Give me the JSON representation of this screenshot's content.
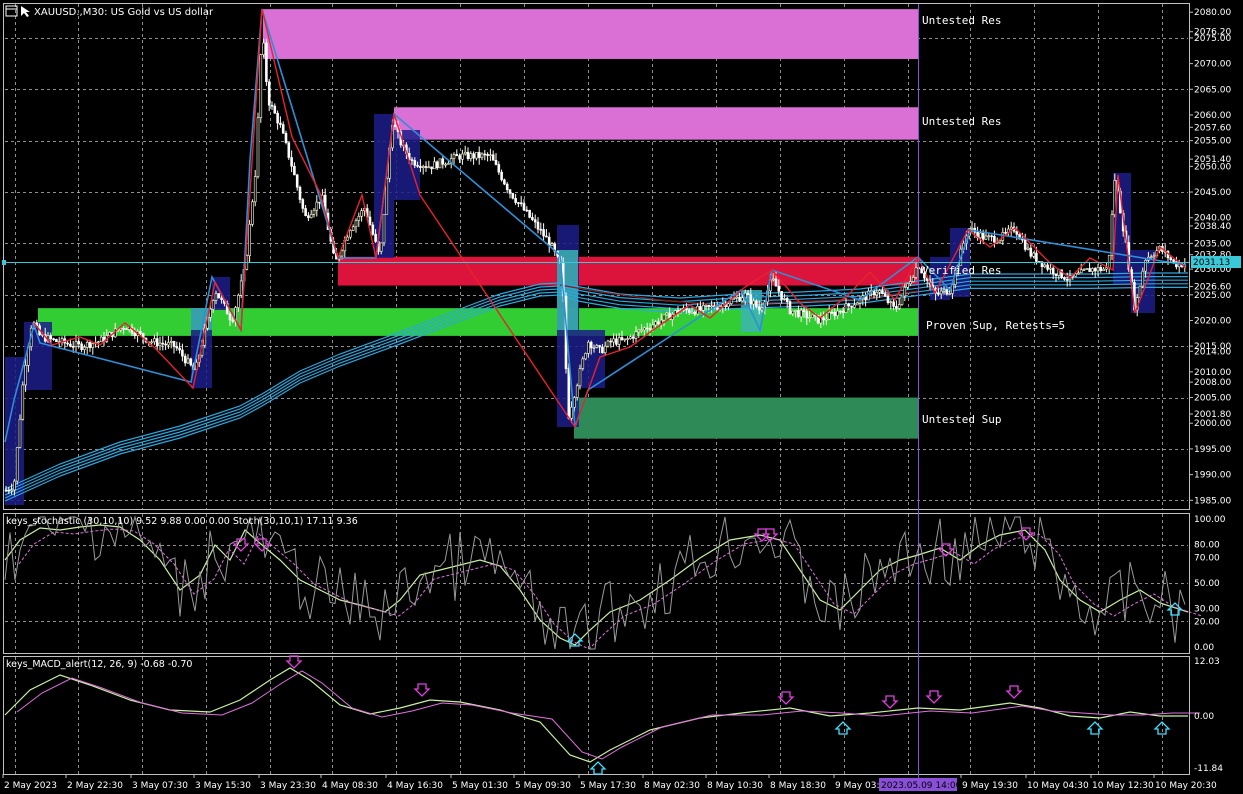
{
  "header": {
    "symbol_title": "XAUUSD.,M30:  US Gold vs US dollar",
    "icons": [
      "window-menu-icon",
      "one-click-trading-icon"
    ]
  },
  "zones": [
    {
      "label": "Untested Res",
      "top": 2080.6,
      "bottom": 2070.9,
      "color": "#da70d6"
    },
    {
      "label": "Untested Res",
      "top": 2061.5,
      "bottom": 2055.2,
      "color": "#da70d6"
    },
    {
      "label": "Verified Res",
      "top": 2032.4,
      "bottom": 2026.8,
      "color": "#dc143c"
    },
    {
      "label": "Proven Sup, Retests=5",
      "top": 2022.4,
      "bottom": 2017.0,
      "color": "#32cd32"
    },
    {
      "label": "Untested Sup",
      "top": 2005.0,
      "bottom": 1997.0,
      "color": "#2e8b57"
    }
  ],
  "price_scale": {
    "labels": [
      "2080.00",
      "2076.20",
      "2075.00",
      "2070.00",
      "2065.00",
      "2060.00",
      "2057.60",
      "2055.00",
      "2051.40",
      "2050.00",
      "2045.00",
      "2040.00",
      "2038.40",
      "2035.00",
      "2032.80",
      "2030.00",
      "2026.60",
      "2025.00",
      "2020.00",
      "2015.00",
      "2014.00",
      "2010.00",
      "2008.00",
      "2005.00",
      "2001.80",
      "2000.00",
      "1995.00",
      "1990.00",
      "1985.00"
    ],
    "current_price": "2031.13",
    "ymin": 1983.5,
    "ymax": 2081.6
  },
  "stoch_panel": {
    "title": "keys_stochastic (30,10,10) 9.52 9.88 0.00 0.00 Stoch(30,10,1) 17.11 9.36",
    "scale_labels": [
      "100.00",
      "80.00",
      "70.00",
      "50.00",
      "30.00",
      "20.00",
      "0.00"
    ]
  },
  "macd_panel": {
    "title": "keys_MACD_alert(12, 26, 9) -0.68 -0.70",
    "scale_labels": [
      "12.03",
      "0.00",
      "-11.84"
    ]
  },
  "time_axis": {
    "labels": [
      "2 May 2023",
      "2 May 22:30",
      "3 May 07:30",
      "3 May 15:30",
      "3 May 23:30",
      "4 May 08:30",
      "4 May 16:30",
      "5 May 01:30",
      "5 May 09:30",
      "5 May 17:30",
      "8 May 02:30",
      "8 May 10:30",
      "8 May 18:30",
      "9 May 03:30",
      "9 May 19:30",
      "10 May 04:30",
      "10 May 12:30",
      "10 May 20:30"
    ],
    "crosshair_label": "2023.05.09 14:00"
  },
  "colors": {
    "background": "#000000",
    "grid": "#c0c0c0",
    "bull_candle": "#ffffe0",
    "bear_candle": "#ffffff",
    "zigzag": "#e8222e",
    "ma_lines": "#29a8e0",
    "crosshair": "#8a4fd8",
    "bid_line": "#39c9d8"
  }
}
